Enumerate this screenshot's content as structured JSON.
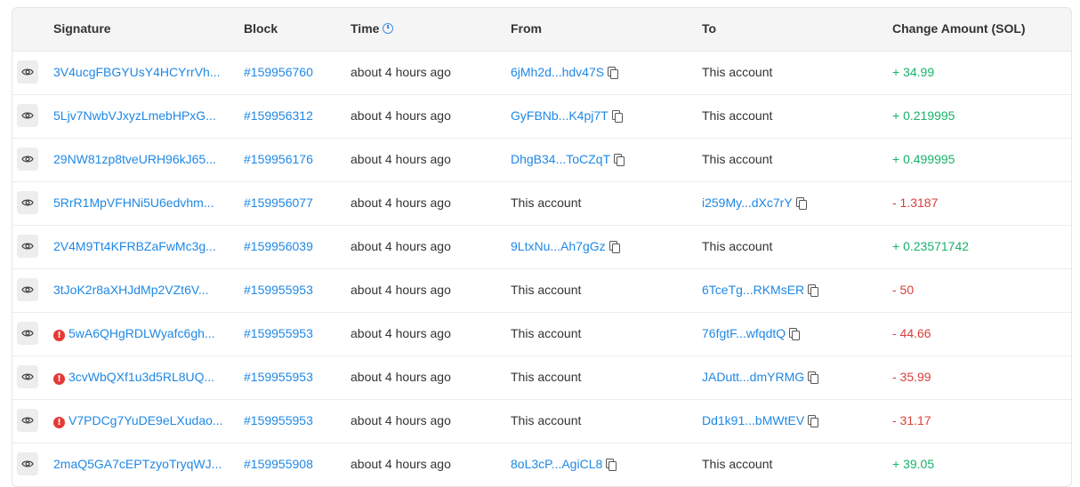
{
  "columns": {
    "signature": "Signature",
    "block": "Block",
    "time": "Time",
    "from": "From",
    "to": "To",
    "change": "Change Amount (SOL)"
  },
  "rows": [
    {
      "signature": "3V4ucgFBGYUsY4HCYrrVh...",
      "error": false,
      "block": "#159956760",
      "time": "about 4 hours ago",
      "from": "6jMh2d...hdv47S",
      "from_is_link": true,
      "to": "This account",
      "to_is_link": false,
      "amount": "+ 34.99",
      "sign": "pos"
    },
    {
      "signature": "5Ljv7NwbVJxyzLmebHPxG...",
      "error": false,
      "block": "#159956312",
      "time": "about 4 hours ago",
      "from": "GyFBNb...K4pj7T",
      "from_is_link": true,
      "to": "This account",
      "to_is_link": false,
      "amount": "+ 0.219995",
      "sign": "pos"
    },
    {
      "signature": "29NW81zp8tveURH96kJ65...",
      "error": false,
      "block": "#159956176",
      "time": "about 4 hours ago",
      "from": "DhgB34...ToCZqT",
      "from_is_link": true,
      "to": "This account",
      "to_is_link": false,
      "amount": "+ 0.499995",
      "sign": "pos"
    },
    {
      "signature": "5RrR1MpVFHNi5U6edvhm...",
      "error": false,
      "block": "#159956077",
      "time": "about 4 hours ago",
      "from": "This account",
      "from_is_link": false,
      "to": "i259My...dXc7rY",
      "to_is_link": true,
      "amount": "- 1.3187",
      "sign": "neg"
    },
    {
      "signature": "2V4M9Tt4KFRBZaFwMc3g...",
      "error": false,
      "block": "#159956039",
      "time": "about 4 hours ago",
      "from": "9LtxNu...Ah7gGz",
      "from_is_link": true,
      "to": "This account",
      "to_is_link": false,
      "amount": "+ 0.23571742",
      "sign": "pos"
    },
    {
      "signature": "3tJoK2r8aXHJdMp2VZt6V...",
      "error": false,
      "block": "#159955953",
      "time": "about 4 hours ago",
      "from": "This account",
      "from_is_link": false,
      "to": "6TceTg...RKMsER",
      "to_is_link": true,
      "amount": "- 50",
      "sign": "neg"
    },
    {
      "signature": "5wA6QHgRDLWyafc6gh...",
      "error": true,
      "block": "#159955953",
      "time": "about 4 hours ago",
      "from": "This account",
      "from_is_link": false,
      "to": "76fgtF...wfqdtQ",
      "to_is_link": true,
      "amount": "- 44.66",
      "sign": "neg"
    },
    {
      "signature": "3cvWbQXf1u3d5RL8UQ...",
      "error": true,
      "block": "#159955953",
      "time": "about 4 hours ago",
      "from": "This account",
      "from_is_link": false,
      "to": "JADutt...dmYRMG",
      "to_is_link": true,
      "amount": "- 35.99",
      "sign": "neg"
    },
    {
      "signature": "V7PDCg7YuDE9eLXudao...",
      "error": true,
      "block": "#159955953",
      "time": "about 4 hours ago",
      "from": "This account",
      "from_is_link": false,
      "to": "Dd1k91...bMWtEV",
      "to_is_link": true,
      "amount": "- 31.17",
      "sign": "neg"
    },
    {
      "signature": "2maQ5GA7cEPTzyoTryqWJ...",
      "error": false,
      "block": "#159955908",
      "time": "about 4 hours ago",
      "from": "8oL3cP...AgiCL8",
      "from_is_link": true,
      "to": "This account",
      "to_is_link": false,
      "amount": "+ 39.05",
      "sign": "pos"
    }
  ],
  "icons": {
    "view": "eye-icon",
    "time_header": "clock-icon",
    "copy": "copy-icon",
    "error": "error-icon"
  },
  "colors": {
    "link": "#1f88e5",
    "positive": "#17b26a",
    "negative": "#d9403a",
    "error": "#e53935"
  }
}
